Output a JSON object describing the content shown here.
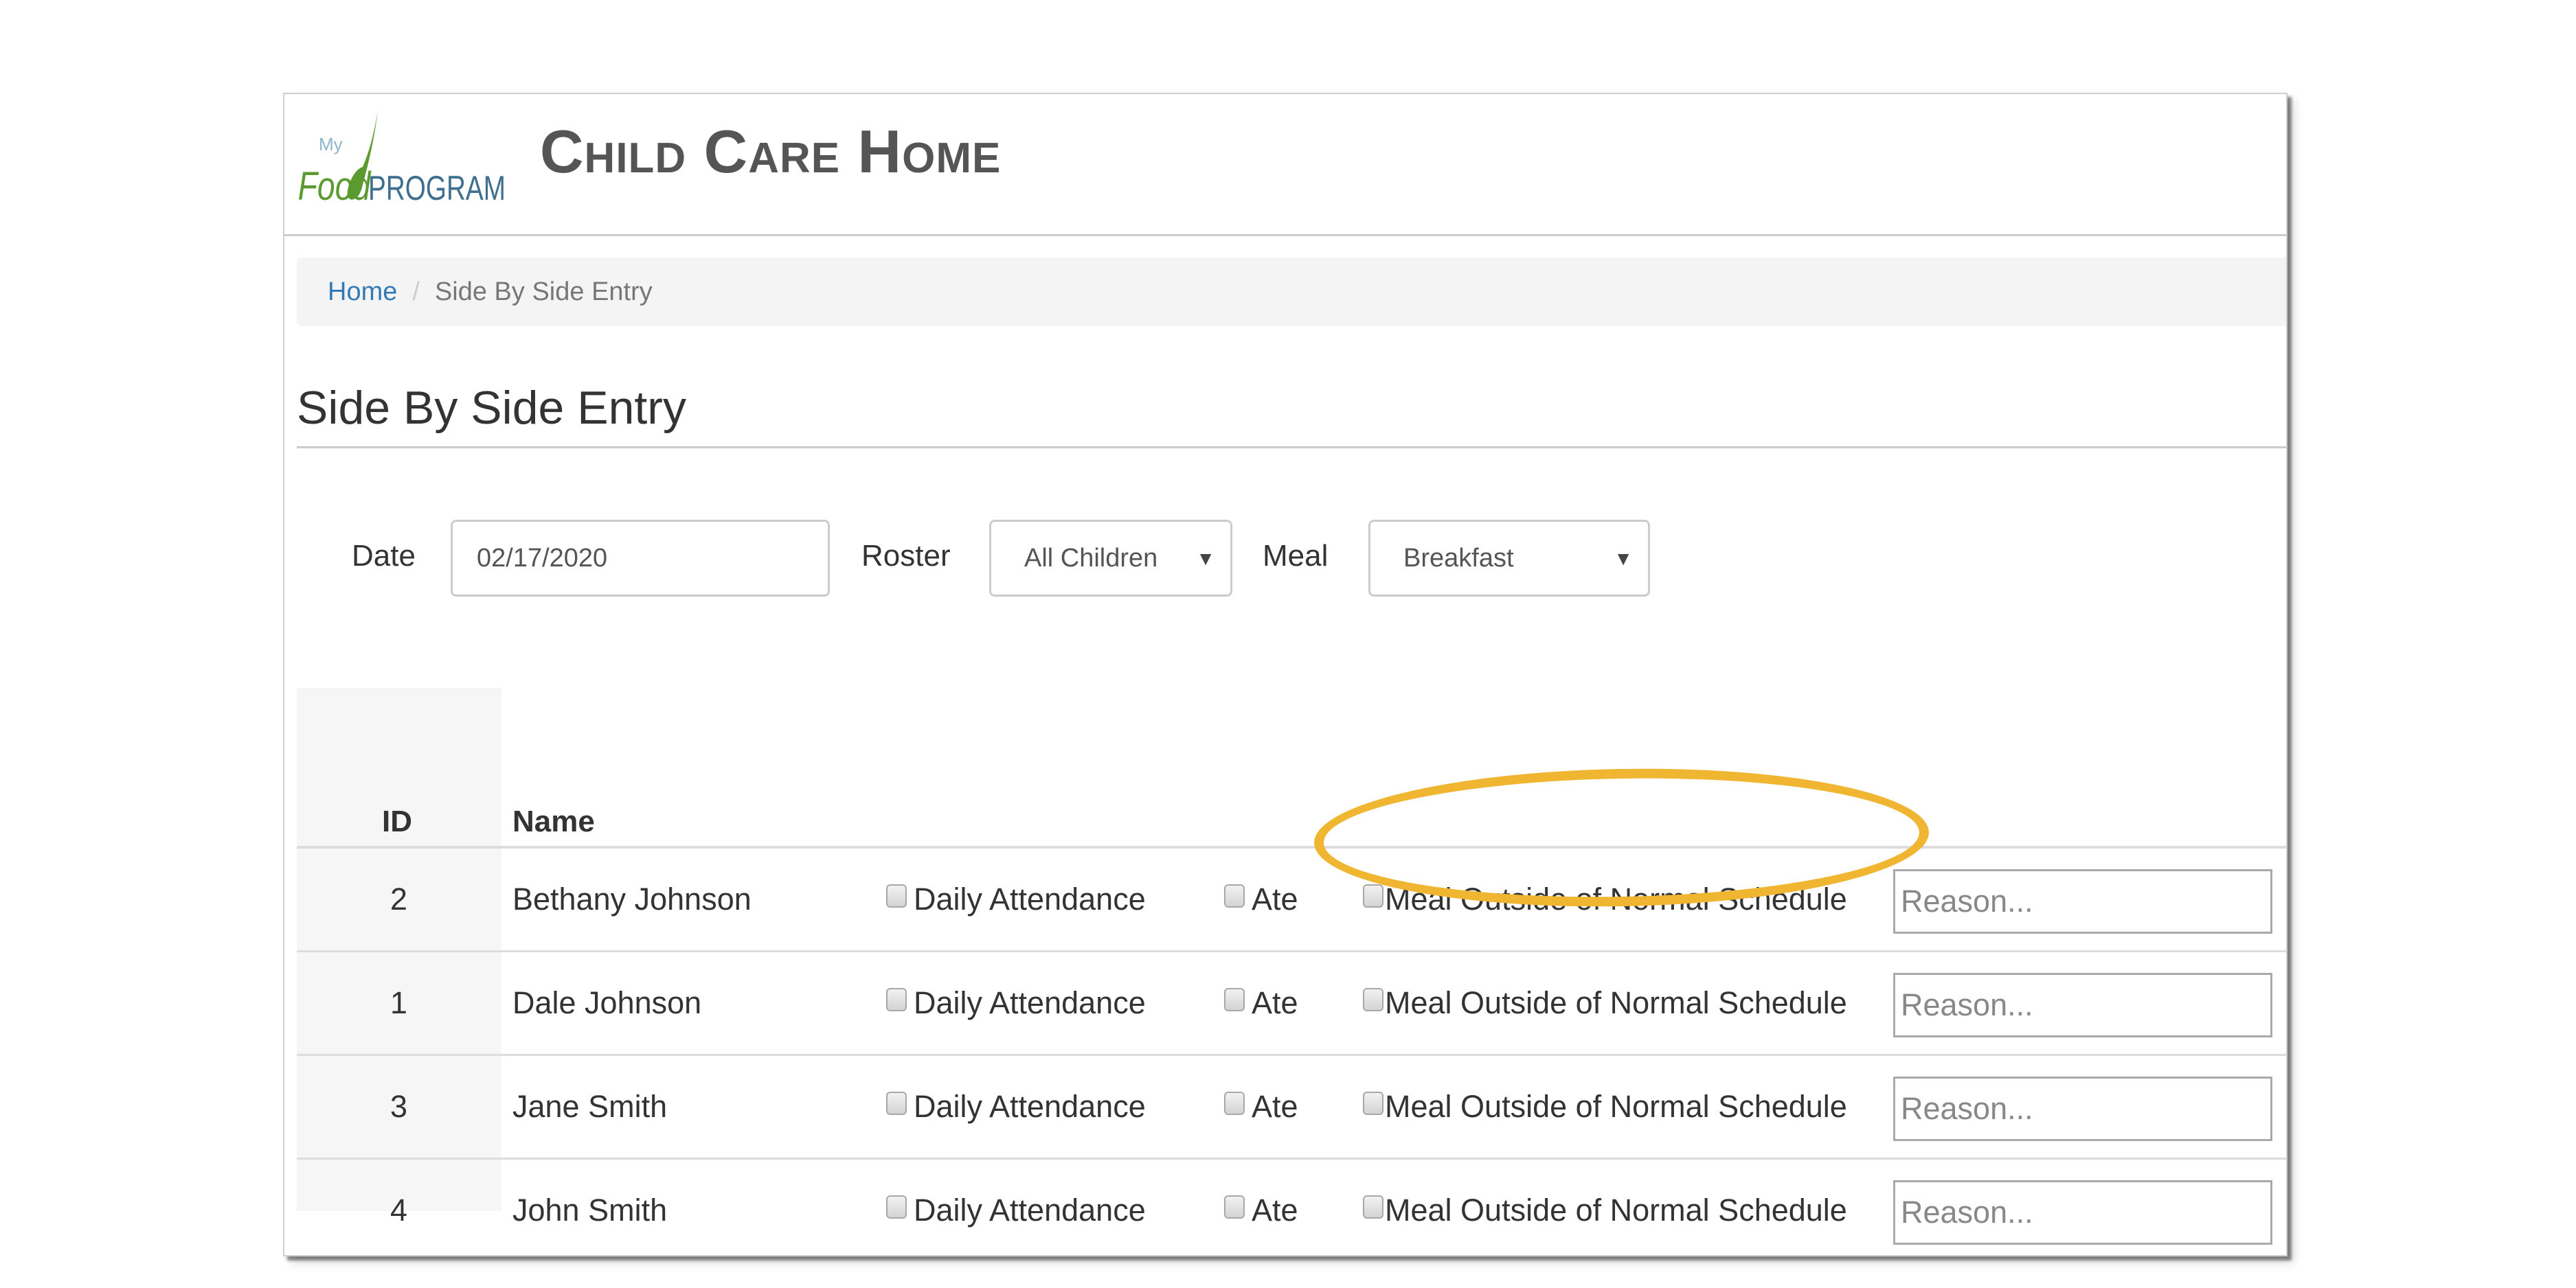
{
  "app": {
    "logo_text_top": "My",
    "logo_text_left": "Food",
    "logo_text_right": "PROGRAM",
    "title": "Child Care Home"
  },
  "breadcrumb": {
    "items": [
      {
        "label": "Home"
      },
      {
        "label": "Side By Side Entry"
      }
    ],
    "separator": "/"
  },
  "page": {
    "title": "Side By Side Entry"
  },
  "filters": {
    "date_label": "Date",
    "date_value": "02/17/2020",
    "roster_label": "Roster",
    "roster_value": "All Children",
    "meal_label": "Meal",
    "meal_value": "Breakfast",
    "caret": "▼"
  },
  "table": {
    "headers": {
      "id": "ID",
      "name": "Name"
    },
    "checkbox_labels": {
      "attendance": "Daily Attendance",
      "ate": "Ate",
      "outside": "Meal Outside of Normal Schedule"
    },
    "reason_placeholder": "Reason...",
    "rows": [
      {
        "id": "2",
        "name": "Bethany Johnson"
      },
      {
        "id": "1",
        "name": "Dale Johnson"
      },
      {
        "id": "3",
        "name": "Jane Smith"
      },
      {
        "id": "4",
        "name": "John Smith"
      }
    ]
  },
  "annotation": {
    "highlight_color": "#f0b531",
    "highlighted": "Meal Outside of Normal Schedule"
  },
  "colors": {
    "link": "#337ab7",
    "logo_green": "#5a9a2e",
    "logo_blue": "#3f6f8f"
  }
}
